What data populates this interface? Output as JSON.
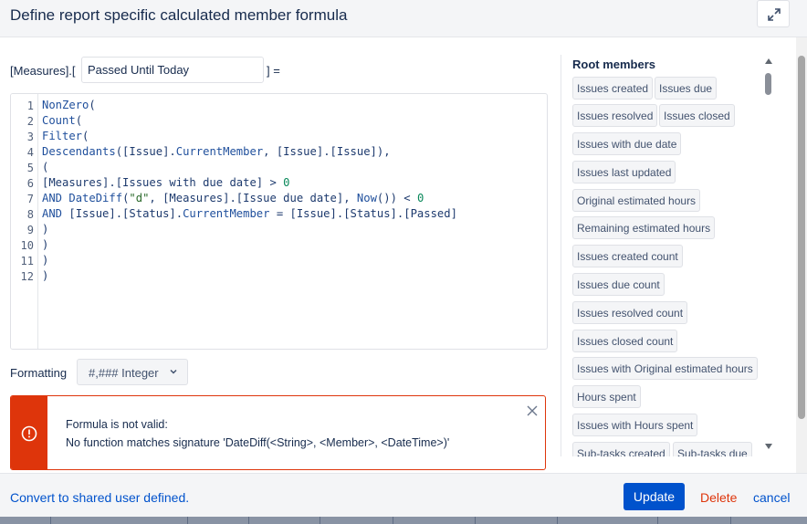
{
  "dialog": {
    "title": "Define report specific calculated member formula",
    "expand_icon": "expand-arrows-icon"
  },
  "member_name": {
    "prefix": "[Measures].[",
    "value": "Passed Until Today",
    "suffix": "] ="
  },
  "formula": {
    "line_numbers": [
      "1",
      "2",
      "3",
      "4",
      "5",
      "6",
      "7",
      "8",
      "9",
      "10",
      "11",
      "12"
    ]
  },
  "formatting": {
    "label": "Formatting",
    "selected": "#,### Integer"
  },
  "error": {
    "icon": "exclamation-circle-icon",
    "line1": "Formula is not valid:",
    "line2": "No function matches signature 'DateDiff(<String>, <Member>, <DateTime>)'"
  },
  "root_members": {
    "title": "Root members",
    "items": [
      "Issues created",
      "Issues due",
      "Issues resolved",
      "Issues closed",
      "Issues with due date",
      "Issues last updated",
      "Original estimated hours",
      "Remaining estimated hours",
      "Issues created count",
      "Issues due count",
      "Issues resolved count",
      "Issues closed count",
      "Issues with Original estimated hours",
      "Hours spent",
      "Issues with Hours spent",
      "Sub-tasks created",
      "Sub-tasks due"
    ]
  },
  "footer": {
    "convert_label": "Convert to shared user defined.",
    "update_label": "Update",
    "delete_label": "Delete",
    "cancel_label": "cancel"
  },
  "colors": {
    "primary": "#0052cc",
    "danger": "#de350b",
    "text": "#172b4d",
    "chip_bg": "#f4f5f7"
  }
}
